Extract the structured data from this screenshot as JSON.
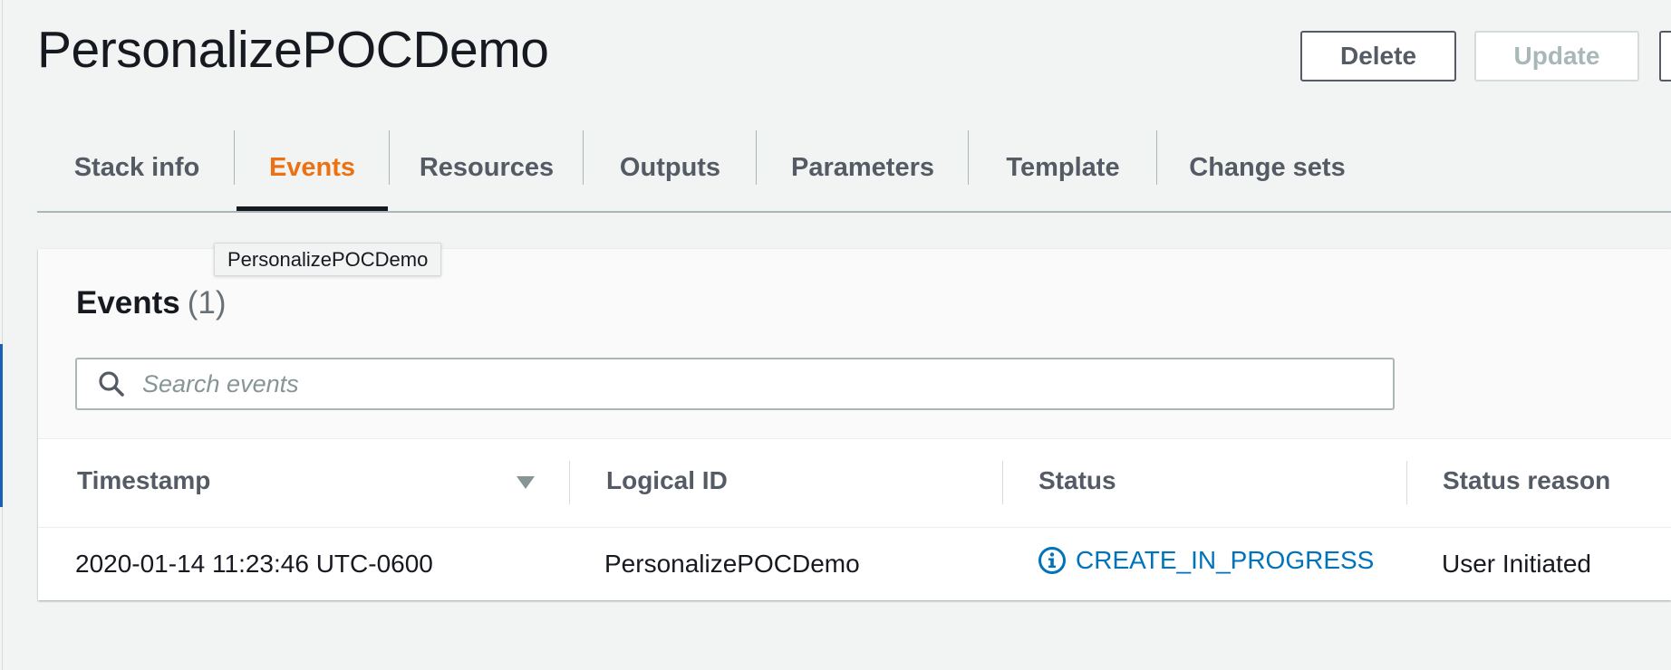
{
  "page": {
    "title": "PersonalizePOCDemo"
  },
  "actions": {
    "delete_label": "Delete",
    "update_label": "Update"
  },
  "tabs": [
    {
      "label": "Stack info",
      "active": false
    },
    {
      "label": "Events",
      "active": true
    },
    {
      "label": "Resources",
      "active": false
    },
    {
      "label": "Outputs",
      "active": false
    },
    {
      "label": "Parameters",
      "active": false
    },
    {
      "label": "Template",
      "active": false
    },
    {
      "label": "Change sets",
      "active": false
    }
  ],
  "tooltip": {
    "text": "PersonalizePOCDemo"
  },
  "events": {
    "title": "Events",
    "count": "(1)",
    "search": {
      "placeholder": "Search events",
      "value": ""
    },
    "columns": [
      "Timestamp",
      "Logical ID",
      "Status",
      "Status reason"
    ],
    "sort_icon": "caret-down-icon",
    "rows": [
      {
        "timestamp": "2020-01-14 11:23:46 UTC-0600",
        "logical_id": "PersonalizePOCDemo",
        "status": "CREATE_IN_PROGRESS",
        "status_icon": "info-icon",
        "status_reason": "User Initiated"
      }
    ]
  },
  "colors": {
    "accent": "#ec7211",
    "link": "#0073bb",
    "text": "#16191f",
    "muted": "#545b64",
    "background": "#f2f3f3"
  }
}
